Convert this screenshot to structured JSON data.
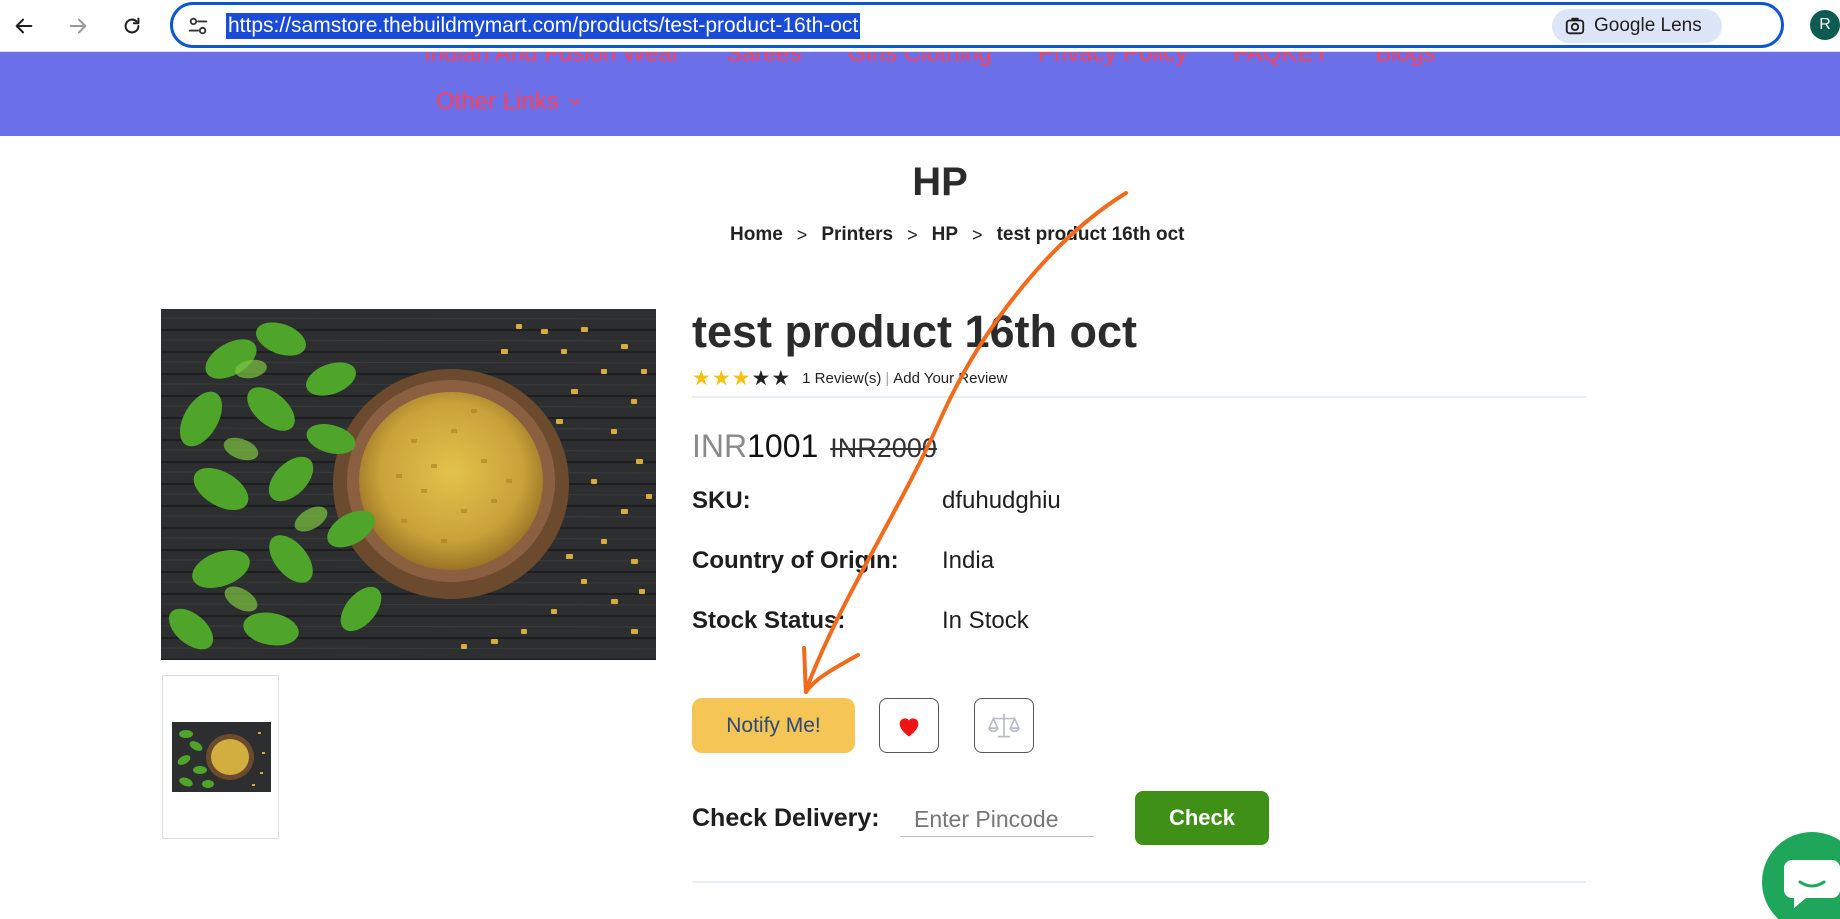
{
  "browser": {
    "url": "https://samstore.thebuildmymart.com/products/test-product-16th-oct",
    "lens_label": "Google Lens",
    "profile_initial": "R"
  },
  "site_nav": {
    "items": [
      "Indian And Fusion Wear",
      "Sarees",
      "Girls Clothing",
      "Privacy Policy",
      "FAQKEY",
      "Blogs"
    ],
    "other_links": "Other Links"
  },
  "category_title": "HP",
  "breadcrumb": [
    "Home",
    "Printers",
    "HP",
    "test product 16th oct"
  ],
  "breadcrumb_sep": ">",
  "product": {
    "title": "test product 16th oct",
    "rating_filled": 3,
    "rating_total": 5,
    "reviews_text": "1 Review(s)",
    "add_review": "Add Your Review",
    "currency": "INR",
    "price": "1001",
    "old_price": "INR2000",
    "attributes": [
      {
        "label": "SKU:",
        "value": "dfuhudghiu"
      },
      {
        "label": "Country of Origin:",
        "value": "India"
      },
      {
        "label": "Stock Status:",
        "value": "In Stock"
      }
    ],
    "notify_label": "Notify Me!",
    "delivery_label": "Check Delivery:",
    "pincode_placeholder": "Enter Pincode",
    "check_label": "Check"
  },
  "colors": {
    "nav_bg": "#6b6fe8",
    "nav_link": "#ff3f5a",
    "notify_bg": "#f5c555",
    "check_bg": "#3f9016",
    "annotation_arrow": "#f26b1d",
    "chat_fab": "#1ea65a"
  }
}
